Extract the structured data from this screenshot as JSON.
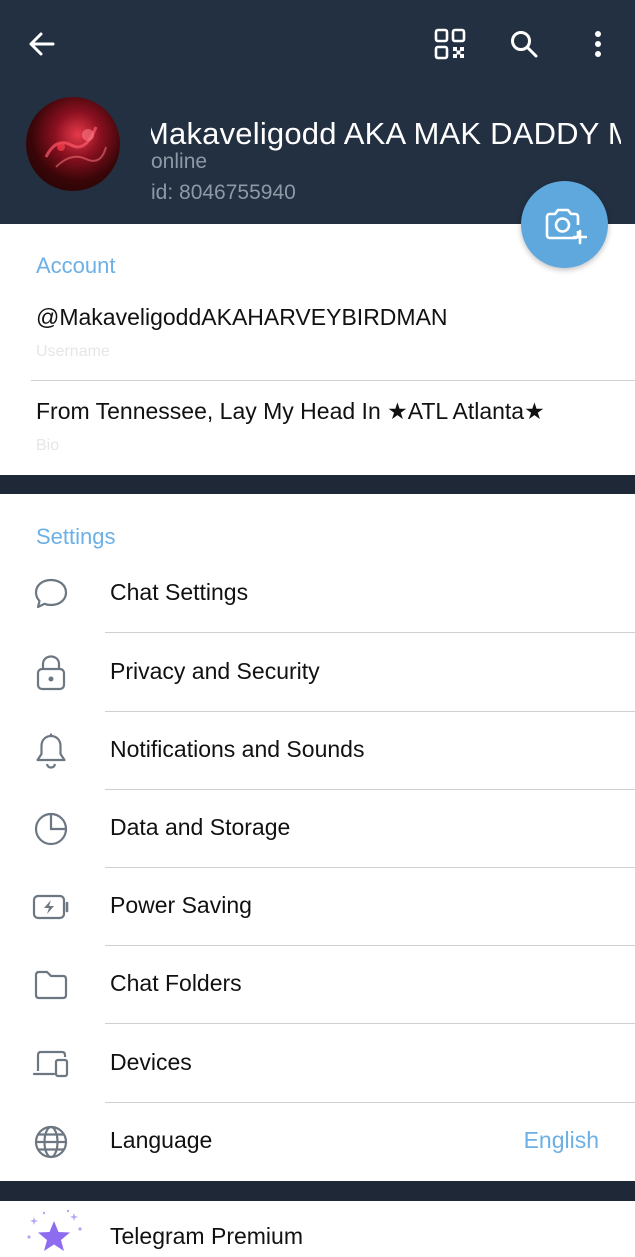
{
  "header": {
    "name": "Makaveligodd AKA MAK DADDY   Makaveligodd",
    "status": "online",
    "user_id": "id: 8046755940"
  },
  "account": {
    "title": "Account",
    "username": "@MakaveligoddAKAHARVEYBIRDMAN",
    "username_caption": "Username",
    "bio": "From Tennessee, Lay My Head In ★ATL Atlanta★",
    "bio_caption": "Bio"
  },
  "settings": {
    "title": "Settings",
    "items": [
      {
        "label": "Chat Settings",
        "icon": "chat-bubble-icon"
      },
      {
        "label": "Privacy and Security",
        "icon": "lock-icon"
      },
      {
        "label": "Notifications and Sounds",
        "icon": "bell-icon"
      },
      {
        "label": "Data and Storage",
        "icon": "pie-chart-icon"
      },
      {
        "label": "Power Saving",
        "icon": "battery-icon"
      },
      {
        "label": "Chat Folders",
        "icon": "folder-icon"
      },
      {
        "label": "Devices",
        "icon": "devices-icon"
      },
      {
        "label": "Language",
        "icon": "globe-icon",
        "value": "English"
      }
    ]
  },
  "premium": {
    "label": "Telegram Premium",
    "icon": "premium-star-icon"
  },
  "colors": {
    "header_bg": "#233041",
    "accent": "#6cb0e6",
    "fab": "#5ea8de",
    "premium_star": "#8e6cf0"
  }
}
